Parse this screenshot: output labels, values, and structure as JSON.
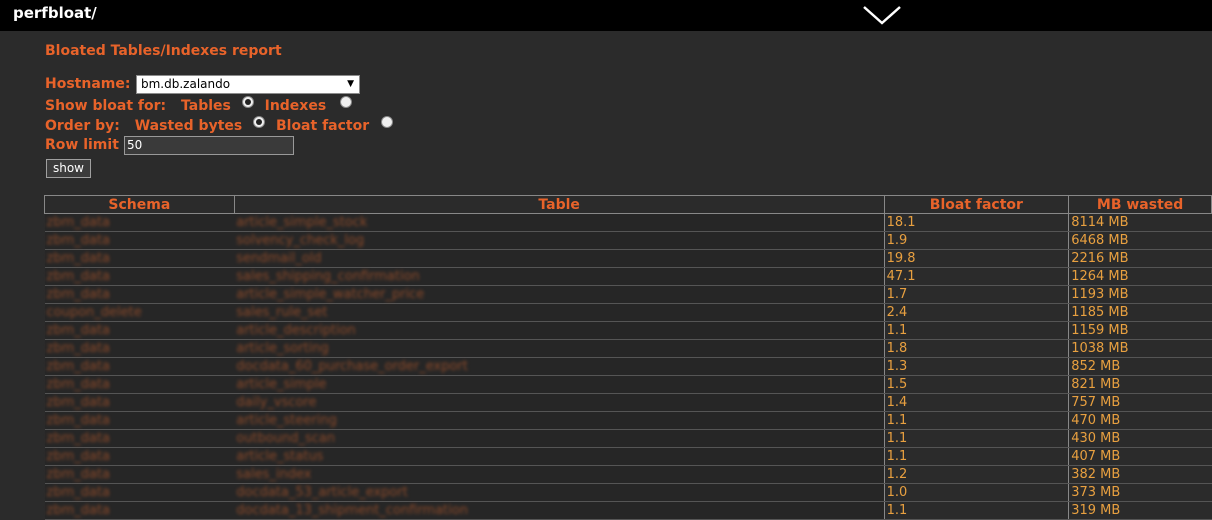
{
  "header": {
    "app_title": "perfbloat/"
  },
  "report": {
    "title": "Bloated Tables/Indexes report"
  },
  "form": {
    "hostname_label": "Hostname:",
    "hostname_value": "bm.db.zalando",
    "show_bloat_label": "Show bloat for:",
    "tables_label": "Tables",
    "indexes_label": "Indexes",
    "tables_checked": true,
    "order_by_label": "Order by:",
    "wasted_bytes_label": "Wasted bytes",
    "bloat_factor_label": "Bloat factor",
    "wasted_bytes_checked": true,
    "row_limit_label": "Row limit",
    "row_limit_value": "50",
    "show_button": "show"
  },
  "table": {
    "columns": [
      "Schema",
      "Table",
      "Bloat factor",
      "MB wasted"
    ],
    "rows": [
      {
        "schema": "zbm_data",
        "table": "article_simple_stock",
        "bloat": "18.1",
        "mb": "8114 MB"
      },
      {
        "schema": "zbm_data",
        "table": "solvency_check_log",
        "bloat": "1.9",
        "mb": "6468 MB"
      },
      {
        "schema": "zbm_data",
        "table": "sendmail_old",
        "bloat": "19.8",
        "mb": "2216 MB"
      },
      {
        "schema": "zbm_data",
        "table": "sales_shipping_confirmation",
        "bloat": "47.1",
        "mb": "1264 MB"
      },
      {
        "schema": "zbm_data",
        "table": "article_simple_watcher_price",
        "bloat": "1.7",
        "mb": "1193 MB"
      },
      {
        "schema": "coupon_delete",
        "table": "sales_rule_set",
        "bloat": "2.4",
        "mb": "1185 MB"
      },
      {
        "schema": "zbm_data",
        "table": "article_description",
        "bloat": "1.1",
        "mb": "1159 MB"
      },
      {
        "schema": "zbm_data",
        "table": "article_sorting",
        "bloat": "1.8",
        "mb": "1038 MB"
      },
      {
        "schema": "zbm_data",
        "table": "docdata_60_purchase_order_export",
        "bloat": "1.3",
        "mb": "852 MB"
      },
      {
        "schema": "zbm_data",
        "table": "article_simple",
        "bloat": "1.5",
        "mb": "821 MB"
      },
      {
        "schema": "zbm_data",
        "table": "daily_vscore",
        "bloat": "1.4",
        "mb": "757 MB"
      },
      {
        "schema": "zbm_data",
        "table": "article_steering",
        "bloat": "1.1",
        "mb": "470 MB"
      },
      {
        "schema": "zbm_data",
        "table": "outbound_scan",
        "bloat": "1.1",
        "mb": "430 MB"
      },
      {
        "schema": "zbm_data",
        "table": "article_status",
        "bloat": "1.1",
        "mb": "407 MB"
      },
      {
        "schema": "zbm_data",
        "table": "sales_index",
        "bloat": "1.2",
        "mb": "382 MB"
      },
      {
        "schema": "zbm_data",
        "table": "docdata_53_article_export",
        "bloat": "1.0",
        "mb": "373 MB"
      },
      {
        "schema": "zbm_data",
        "table": "docdata_13_shipment_confirmation",
        "bloat": "1.1",
        "mb": "319 MB"
      }
    ]
  },
  "icons": {
    "toggle": "chevron-down-icon",
    "select_arrow": "dropdown-arrow-icon"
  },
  "colors": {
    "accent": "#e8632a",
    "value": "#e8a040",
    "background": "#2b2b2b",
    "topbar": "#000000"
  }
}
